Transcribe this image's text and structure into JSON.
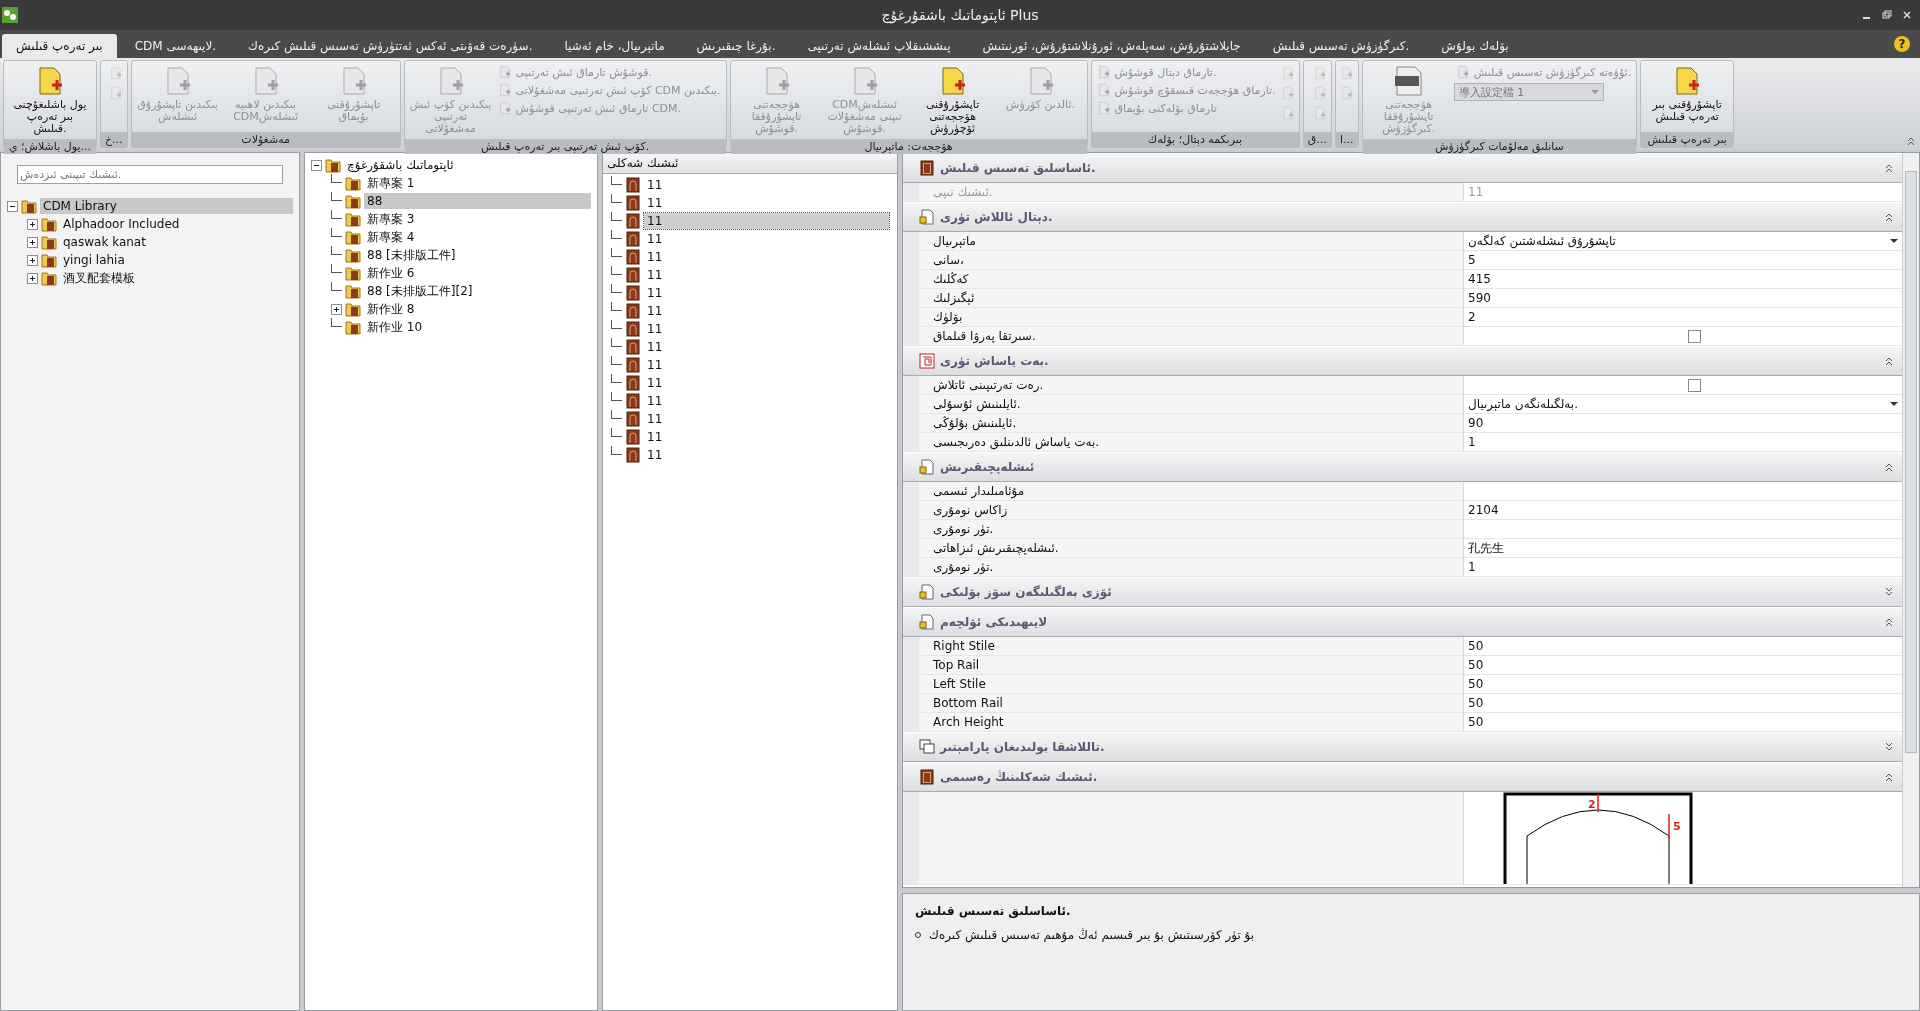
{
  "window": {
    "title": "ئاپتوماتىك باشقۇرغۇچ Plus",
    "help_button": "?"
  },
  "tabs": [
    {
      "label": "بۆلەك بولۇش",
      "selected": false
    },
    {
      "label": "كىرگۈزۈش تەسىس قىلىش.",
      "selected": false
    },
    {
      "label": "جايلاشتۇرۇش، سەپلەش، ئورۇنلاشتۇرۇش، ئورنىتىش",
      "selected": false
    },
    {
      "label": "پىششىقلاپ ئىشلەش تەرتىپى",
      "selected": false
    },
    {
      "label": "بۇرغا چىقىرىش.",
      "selected": false
    },
    {
      "label": "ماتېرىيال، خام ئەشيا",
      "selected": false
    },
    {
      "label": "سۈرەت قەۋىتى ئەكس ئەتتۈرۈش تەسىس قىلىش كىرەك.",
      "selected": false
    },
    {
      "label": "CDM لايىھەسى.",
      "selected": false
    },
    {
      "label": "بىر تەرەپ قىلىش",
      "selected": true
    }
  ],
  "ribbon": {
    "groups": [
      {
        "label": "بىر تەرەپ قىلىش",
        "items": [
          {
            "kind": "large",
            "label": "تاپشۇرۇقنى بىر تەرەپ قىلىش",
            "disabled": false
          }
        ]
      },
      {
        "label": "سانلىق مەلۇمات كىرگۈزۈش",
        "items": [
          {
            "kind": "stack",
            "items": [
              {
                "kind": "small",
                "label": "ئۇۋەتە كىرگۈزۈش تەسىس قىلىش.",
                "disabled": true
              },
              {
                "kind": "dropdown",
                "label": "導入設定檔 1",
                "disabled": true
              }
            ]
          },
          {
            "kind": "csv",
            "label": "ھۆججەتنى تاپشۇرۇققا كىرگۈزۈش.",
            "disabled": true
          }
        ]
      },
      {
        "label": "ا...",
        "items": [
          {
            "kind": "stack",
            "items": [
              {
                "kind": "icon",
                "disabled": true
              },
              {
                "kind": "icon",
                "disabled": true
              }
            ]
          }
        ]
      },
      {
        "label": "ق...",
        "items": [
          {
            "kind": "stack",
            "items": [
              {
                "kind": "icon",
                "disabled": true
              },
              {
                "kind": "icon",
                "disabled": true
              },
              {
                "kind": "icon",
                "disabled": true
              }
            ]
          }
        ]
      },
      {
        "label": "بىرىكمە دېتال؛ بۆلەك",
        "items": [
          {
            "kind": "stack",
            "items": [
              {
                "kind": "icon",
                "disabled": true
              },
              {
                "kind": "icon",
                "disabled": true
              },
              {
                "kind": "icon",
                "disabled": true
              }
            ]
          },
          {
            "kind": "stack",
            "items": [
              {
                "kind": "small",
                "label": "تارماق دېتال قوشۇش.",
                "disabled": true
              },
              {
                "kind": "small",
                "label": "تارماق ھۆججەت قىسقۇچ قوشۇش.",
                "disabled": true
              },
              {
                "kind": "small",
                "label": "تارماق بۆلەكنى بۇيماق",
                "disabled": true
              }
            ]
          }
        ]
      },
      {
        "label": "ھۆججەت: ماتېرىيال",
        "items": [
          {
            "kind": "large",
            "label": "ئالدىن كۆرۈش.",
            "disabled": true
          },
          {
            "kind": "large",
            "label": "تاپشۇرۇقنى ھۆججەتنى ئۆچۈرۈش",
            "disabled": false
          },
          {
            "kind": "large",
            "label": "CDMئىشلەش تىپنى مەشغۇلات قوشۇش.",
            "disabled": true
          },
          {
            "kind": "large",
            "label": "ھۆججەتنى تاپشۇرۇققا قوشۇش.",
            "disabled": true
          }
        ]
      },
      {
        "label": "كۆپ ئىش تەرتىپى بىر تەرەپ قىلىش.",
        "items": [
          {
            "kind": "stack",
            "items": [
              {
                "kind": "small",
                "label": "قوشۇش تارماق ئىش تەرتىپى.",
                "disabled": true
              },
              {
                "kind": "small",
                "label": "كۆپ ئىش تەرتىپى مەشغۇلاتى CDM بىكىدىن.",
                "disabled": true
              },
              {
                "kind": "small",
                "label": "تارماق ئىش تەرتىپى قوشۇش CDM.",
                "disabled": true
              }
            ]
          },
          {
            "kind": "large",
            "label": "بىكىدىن كۆپ ئىش تەرتىپى مەشغۇلاتى",
            "disabled": true
          }
        ]
      },
      {
        "label": "مەشغۇلات",
        "items": [
          {
            "kind": "large",
            "label": "تاپشۇرۇقنى بۇيماق",
            "disabled": true
          },
          {
            "kind": "large",
            "label": "بىكىدىن لاھىيە CDMئىشلەش",
            "disabled": true
          },
          {
            "kind": "large",
            "label": "بىكىدىن تاپشۇرۇق ئىشلەش",
            "disabled": true
          }
        ]
      },
      {
        "label": "خ...",
        "items": [
          {
            "kind": "stack",
            "items": [
              {
                "kind": "icon",
                "disabled": true
              },
              {
                "kind": "icon",
                "disabled": true
              }
            ]
          }
        ]
      },
      {
        "label": "يول باشلاش؛ ي...",
        "items": [
          {
            "kind": "large",
            "label": "يول باشلىغۇچنى بىر تەرەپ قىلىش.",
            "disabled": false
          }
        ]
      }
    ]
  },
  "library_pane": {
    "search": {
      "placeholder": "ئىشىك تىپىنى ئىزدەش."
    },
    "tree": [
      {
        "label": "CDM Library",
        "expanded": true,
        "selected": true,
        "children": [
          {
            "label": "Alphadoor Included",
            "expanded": false,
            "selected": false
          },
          {
            "label": "qaswak kanat",
            "expanded": false,
            "selected": false
          },
          {
            "label": "yingi lahia",
            "expanded": false,
            "selected": false
          },
          {
            "label": "酒叉配套模板",
            "expanded": false,
            "selected": false
          }
        ]
      }
    ]
  },
  "job_pane": {
    "tree": [
      {
        "label": "ئاپتوماتىك باشقۇرغۇچ",
        "expanded": true,
        "selected": false,
        "children": [
          {
            "label": "新專案 1",
            "selected": false
          },
          {
            "label": "88",
            "selected": true
          },
          {
            "label": "新專案 3",
            "selected": false
          },
          {
            "label": "新專案 4",
            "selected": false
          },
          {
            "label": "88 [未排版工件]",
            "selected": false
          },
          {
            "label": "新作业 6",
            "selected": false
          },
          {
            "label": "88 [未排版工件][2]",
            "selected": false
          },
          {
            "label": "新作业 8",
            "expanded": false,
            "selected": false
          },
          {
            "label": "新作业 10",
            "selected": false
          }
        ]
      }
    ]
  },
  "door_pane": {
    "header": "ئىشىك شەكلى",
    "items": [
      {
        "label": "11",
        "selected": false
      },
      {
        "label": "11",
        "selected": false
      },
      {
        "label": "11",
        "selected": true
      },
      {
        "label": "11",
        "selected": false
      },
      {
        "label": "11",
        "selected": false
      },
      {
        "label": "11",
        "selected": false
      },
      {
        "label": "11",
        "selected": false
      },
      {
        "label": "11",
        "selected": false
      },
      {
        "label": "11",
        "selected": false
      },
      {
        "label": "11",
        "selected": false
      },
      {
        "label": "11",
        "selected": false
      },
      {
        "label": "11",
        "selected": false
      },
      {
        "label": "11",
        "selected": false
      },
      {
        "label": "11",
        "selected": false
      },
      {
        "label": "11",
        "selected": false
      },
      {
        "label": "11",
        "selected": false
      }
    ]
  },
  "properties": {
    "sections": [
      {
        "title": "ئاساسلىق تەسىس قىلىش.",
        "expanded": true,
        "rows": [
          {
            "kind": "text",
            "label": "ئىشىك تىپى.",
            "value": "11",
            "disabled": true
          }
        ]
      },
      {
        "title": "دېتال ئاللاش تۈرى.",
        "expanded": true,
        "rows": [
          {
            "kind": "dropdown",
            "label": "ماتېرىيال",
            "value": "تاپشۇرۇق ئىشلەشتىن كەلگەن",
            "disabled": false
          },
          {
            "kind": "text",
            "label": "سانى،",
            "value": "5",
            "disabled": false
          },
          {
            "kind": "text",
            "label": "كەڭلىك",
            "value": "415",
            "disabled": false
          },
          {
            "kind": "text",
            "label": "ئېگىزلىك",
            "value": "590",
            "disabled": false
          },
          {
            "kind": "text",
            "label": "بۆلۈك",
            "value": "2",
            "disabled": false
          },
          {
            "kind": "checkbox",
            "label": "سىرتقا پەرۋا قىلماق.",
            "checked": false,
            "disabled": false
          }
        ]
      },
      {
        "title": "بەت ياساش تۈرى.",
        "expanded": true,
        "rows": [
          {
            "kind": "checkbox",
            "label": "رەت تەرتىپىنى ئاتلاش.",
            "checked": false,
            "disabled": false
          },
          {
            "kind": "dropdown",
            "label": "ئايلىنىش ئۇسۇلى.",
            "value": "بەلگىلەنگەن ماتېرىيال.",
            "disabled": false
          },
          {
            "kind": "text",
            "label": "ئايلىنىش بۇلۇڭى.",
            "value": "90",
            "disabled": false
          },
          {
            "kind": "text",
            "label": "بەت ياساش ئالدىنلىق دەرىجىسى.",
            "value": "1",
            "disabled": false
          }
        ]
      },
      {
        "title": "ئىشلەپچىقىرىش",
        "expanded": true,
        "rows": [
          {
            "kind": "text",
            "label": "مۇئامىلىدار ئىسمى",
            "disabled": false
          },
          {
            "kind": "text",
            "label": "زاكاس نومۇرى",
            "value": "2104",
            "disabled": false
          },
          {
            "kind": "text",
            "label": "تۈر نومۇرى.",
            "disabled": false
          },
          {
            "kind": "text",
            "label": "ئىشلەپچىقىرىش ئىزاھاتى.",
            "value": "孔先生",
            "disabled": false
          },
          {
            "kind": "text",
            "label": "تۈر نومۇرى.",
            "value": "1",
            "disabled": false
          }
        ]
      },
      {
        "title": "ئۆزى بەلگىلىگەن سۆز بۆلىكى",
        "expanded": false
      },
      {
        "title": "لايىھىدىكى ئۆلچەم",
        "expanded": true,
        "rows": [
          {
            "kind": "text",
            "label": "Right Stile",
            "value": "50",
            "disabled": false
          },
          {
            "kind": "text",
            "label": "Top Rail",
            "value": "50",
            "disabled": false
          },
          {
            "kind": "text",
            "label": "Left Stile",
            "value": "50",
            "disabled": false
          },
          {
            "kind": "text",
            "label": "Bottom Rail",
            "value": "50",
            "disabled": false
          },
          {
            "kind": "text",
            "label": "Arch Height",
            "value": "50",
            "disabled": false
          }
        ]
      },
      {
        "title": "تاللاشقا بولىدىغان پارامېتىر.",
        "expanded": false
      },
      {
        "title": "ئىشىك شەكلىنىڭ رەسىمى.",
        "expanded": true,
        "rows": [
          {
            "kind": "preview",
            "labels": [
              "2",
              "5"
            ]
          }
        ]
      }
    ]
  },
  "help_pane": {
    "title": "ئاساسلىق تەسىس قىلىش.",
    "bullets": [
      "بۇ تۈر كۆرسىتىش بۇ بىر قىسىم ئەڭ مۇھىم تەسىس قىلىش كىرەك"
    ]
  }
}
